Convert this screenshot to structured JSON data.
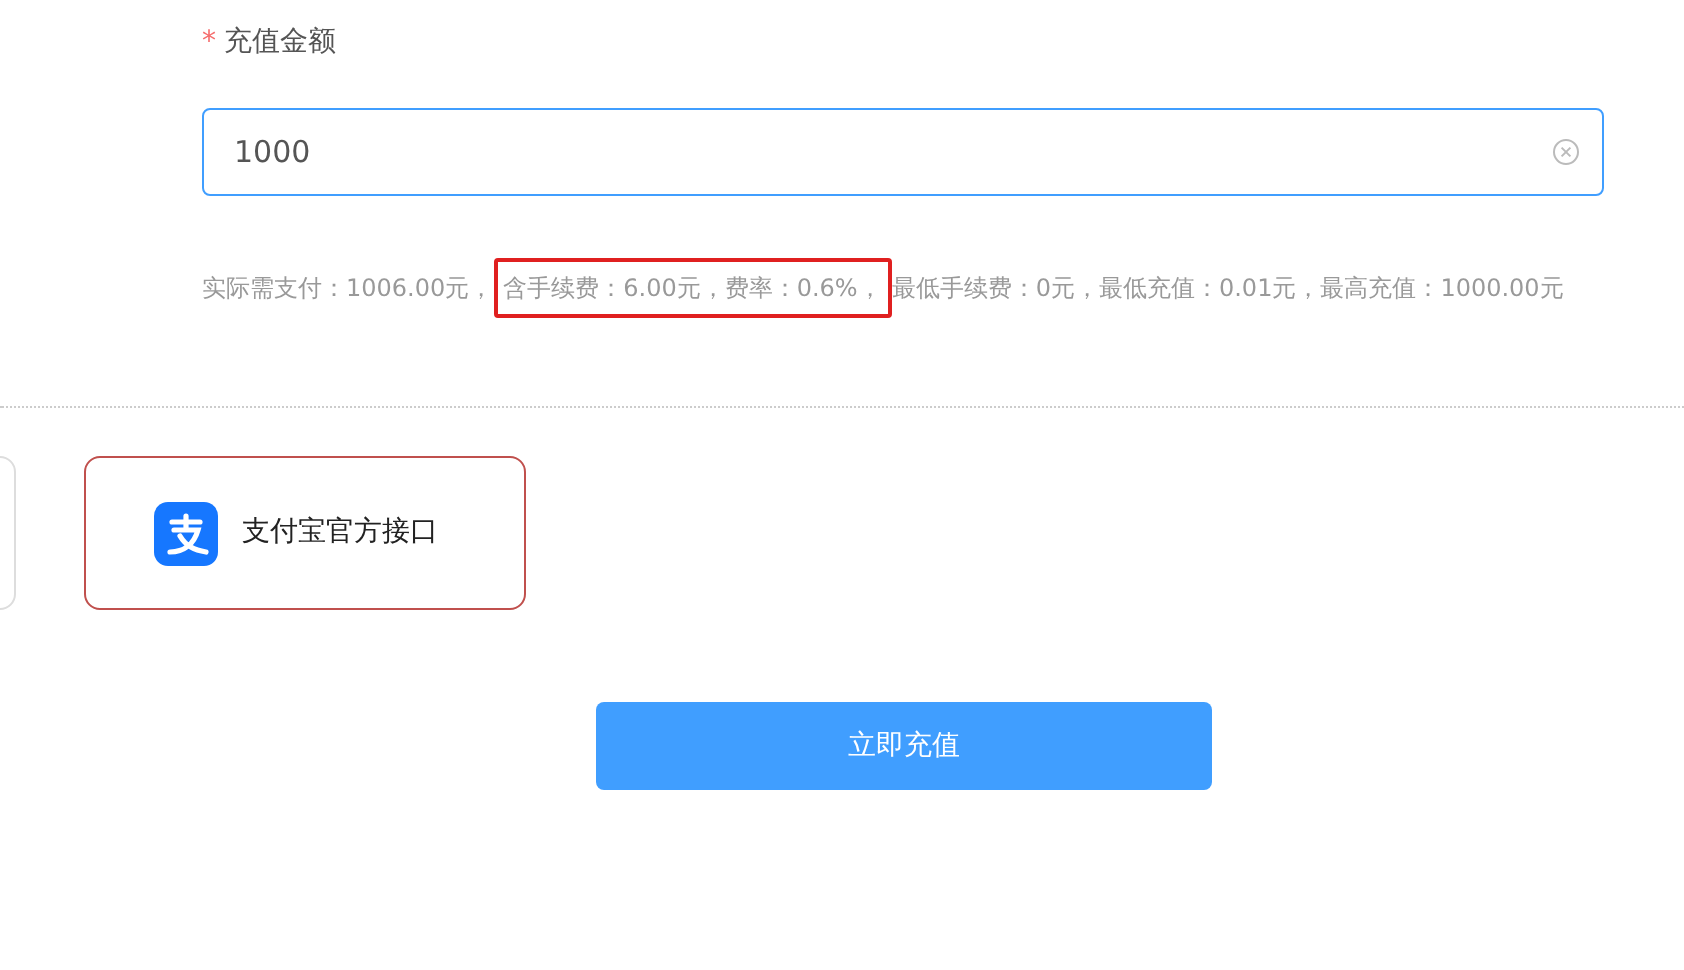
{
  "form": {
    "label": "充值金额",
    "required_mark": "*",
    "amount": {
      "value": "1000",
      "clearable": true
    },
    "hint": {
      "before": "实际需支付：1006.00元，",
      "highlighted": "含手续费：6.00元，费率：0.6%，",
      "after": "最低手续费：0元，最低充值：0.01元，最高充值：1000.00元"
    }
  },
  "payment_methods": [
    {
      "selected": false
    },
    {
      "label": "支付宝官方接口",
      "selected": true
    }
  ],
  "submit": {
    "label": "立即充值"
  }
}
